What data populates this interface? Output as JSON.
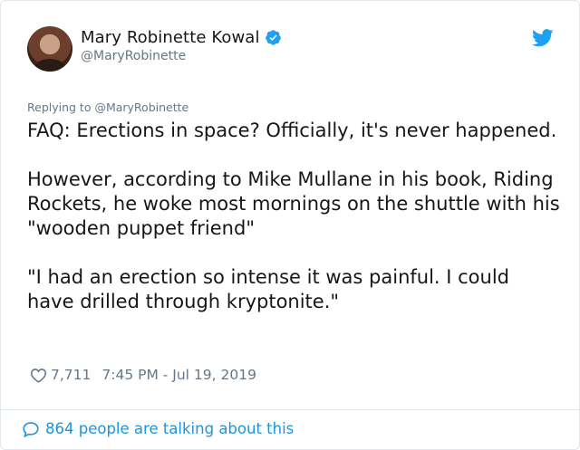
{
  "author": {
    "display_name": "Mary Robinette Kowal",
    "handle": "@MaryRobinette",
    "verified": true
  },
  "reply_context": "Replying to @MaryRobinette",
  "tweet": {
    "paragraphs": [
      "FAQ: Erections in space? Officially, it's never happened.",
      "However, according to Mike Mullane in his book, Riding Rockets, he woke most mornings on the shuttle with his \"wooden puppet friend\"",
      "\"I had an erection so intense it was painful. I could have drilled through kryptonite.\""
    ],
    "like_count": "7,711",
    "timestamp": "7:45 PM - Jul 19, 2019"
  },
  "footer": {
    "conversation_text": "864 people are talking about this"
  },
  "icons": {
    "verified": "verified-badge-icon",
    "brand": "twitter-bird-icon",
    "like": "heart-icon",
    "conversation": "speech-bubble-icon"
  },
  "colors": {
    "accent": "#1da1f2",
    "link": "#1b95e0",
    "muted": "#657786",
    "text": "#14171a",
    "border": "#e1e8ed"
  }
}
